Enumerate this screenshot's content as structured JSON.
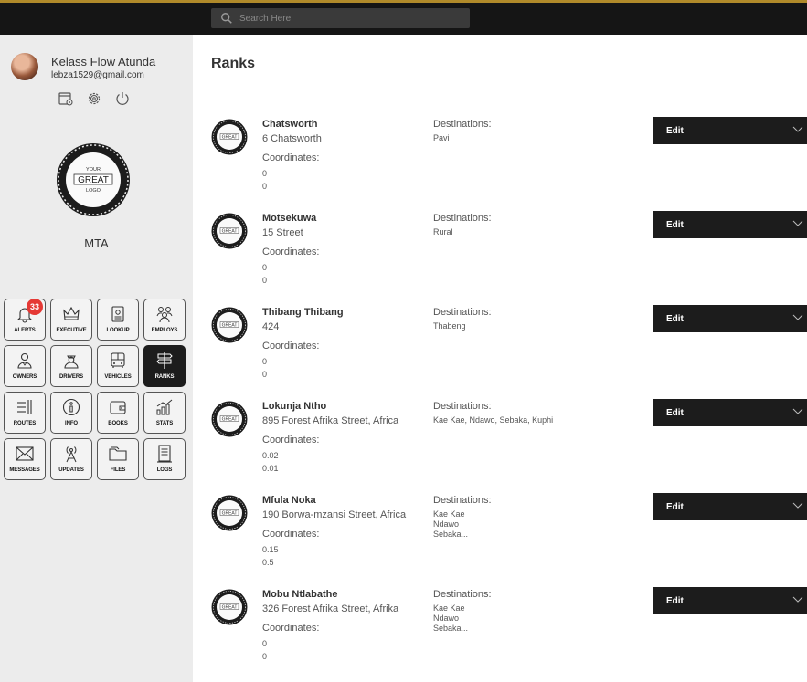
{
  "search": {
    "placeholder": "Search Here"
  },
  "user": {
    "name": "Kelass Flow Atunda",
    "email": "lebza1529@gmail.com"
  },
  "org": {
    "name": "MTA",
    "logo_lines": [
      "YOUR",
      "GREAT",
      "LOGO"
    ]
  },
  "tiles": [
    {
      "label": "ALERTS",
      "icon": "bell-icon",
      "badge": "33"
    },
    {
      "label": "EXECUTIVE",
      "icon": "crown-icon"
    },
    {
      "label": "LOOKUP",
      "icon": "lookup-icon"
    },
    {
      "label": "EMPLOYS",
      "icon": "employees-icon"
    },
    {
      "label": "OWNERS",
      "icon": "owner-icon"
    },
    {
      "label": "DRIVERS",
      "icon": "driver-icon"
    },
    {
      "label": "VEHICLES",
      "icon": "bus-icon"
    },
    {
      "label": "RANKS",
      "icon": "signpost-icon",
      "active": true
    },
    {
      "label": "ROUTES",
      "icon": "routes-icon"
    },
    {
      "label": "INFO",
      "icon": "info-icon"
    },
    {
      "label": "BOOKS",
      "icon": "wallet-icon"
    },
    {
      "label": "STATS",
      "icon": "stats-icon"
    },
    {
      "label": "MESSAGES",
      "icon": "envelope-icon"
    },
    {
      "label": "UPDATES",
      "icon": "antenna-icon"
    },
    {
      "label": "FILES",
      "icon": "folder-icon"
    },
    {
      "label": "LOGS",
      "icon": "log-icon"
    }
  ],
  "page": {
    "title": "Ranks"
  },
  "labels": {
    "coordinates": "Coordinates:",
    "destinations": "Destinations:",
    "edit": "Edit"
  },
  "ranks": [
    {
      "name": "Chatsworth",
      "address": "6 Chatsworth",
      "coord1": "0",
      "coord2": "0",
      "destinations": [
        "Pavi"
      ]
    },
    {
      "name": "Motsekuwa",
      "address": "15 Street",
      "coord1": "0",
      "coord2": "0",
      "destinations": [
        "Rural"
      ]
    },
    {
      "name": "Thibang Thibang",
      "address": "424",
      "coord1": "0",
      "coord2": "0",
      "destinations": [
        "Thabeng"
      ]
    },
    {
      "name": "Lokunja Ntho",
      "address": "895 Forest Afrika Street, Africa",
      "coord1": "0.02",
      "coord2": "0.01",
      "destinations": [
        "Kae Kae, Ndawo, Sebaka, Kuphi"
      ]
    },
    {
      "name": "Mfula Noka",
      "address": "190 Borwa-mzansi Street, Africa",
      "coord1": "0.15",
      "coord2": "0.5",
      "destinations": [
        "Kae Kae",
        "Ndawo",
        "Sebaka..."
      ]
    },
    {
      "name": "Mobu Ntlabathe",
      "address": "326 Forest Afrika Street, Afrika",
      "coord1": "0",
      "coord2": "0",
      "destinations": [
        "Kae Kae",
        "Ndawo",
        "Sebaka..."
      ]
    }
  ]
}
